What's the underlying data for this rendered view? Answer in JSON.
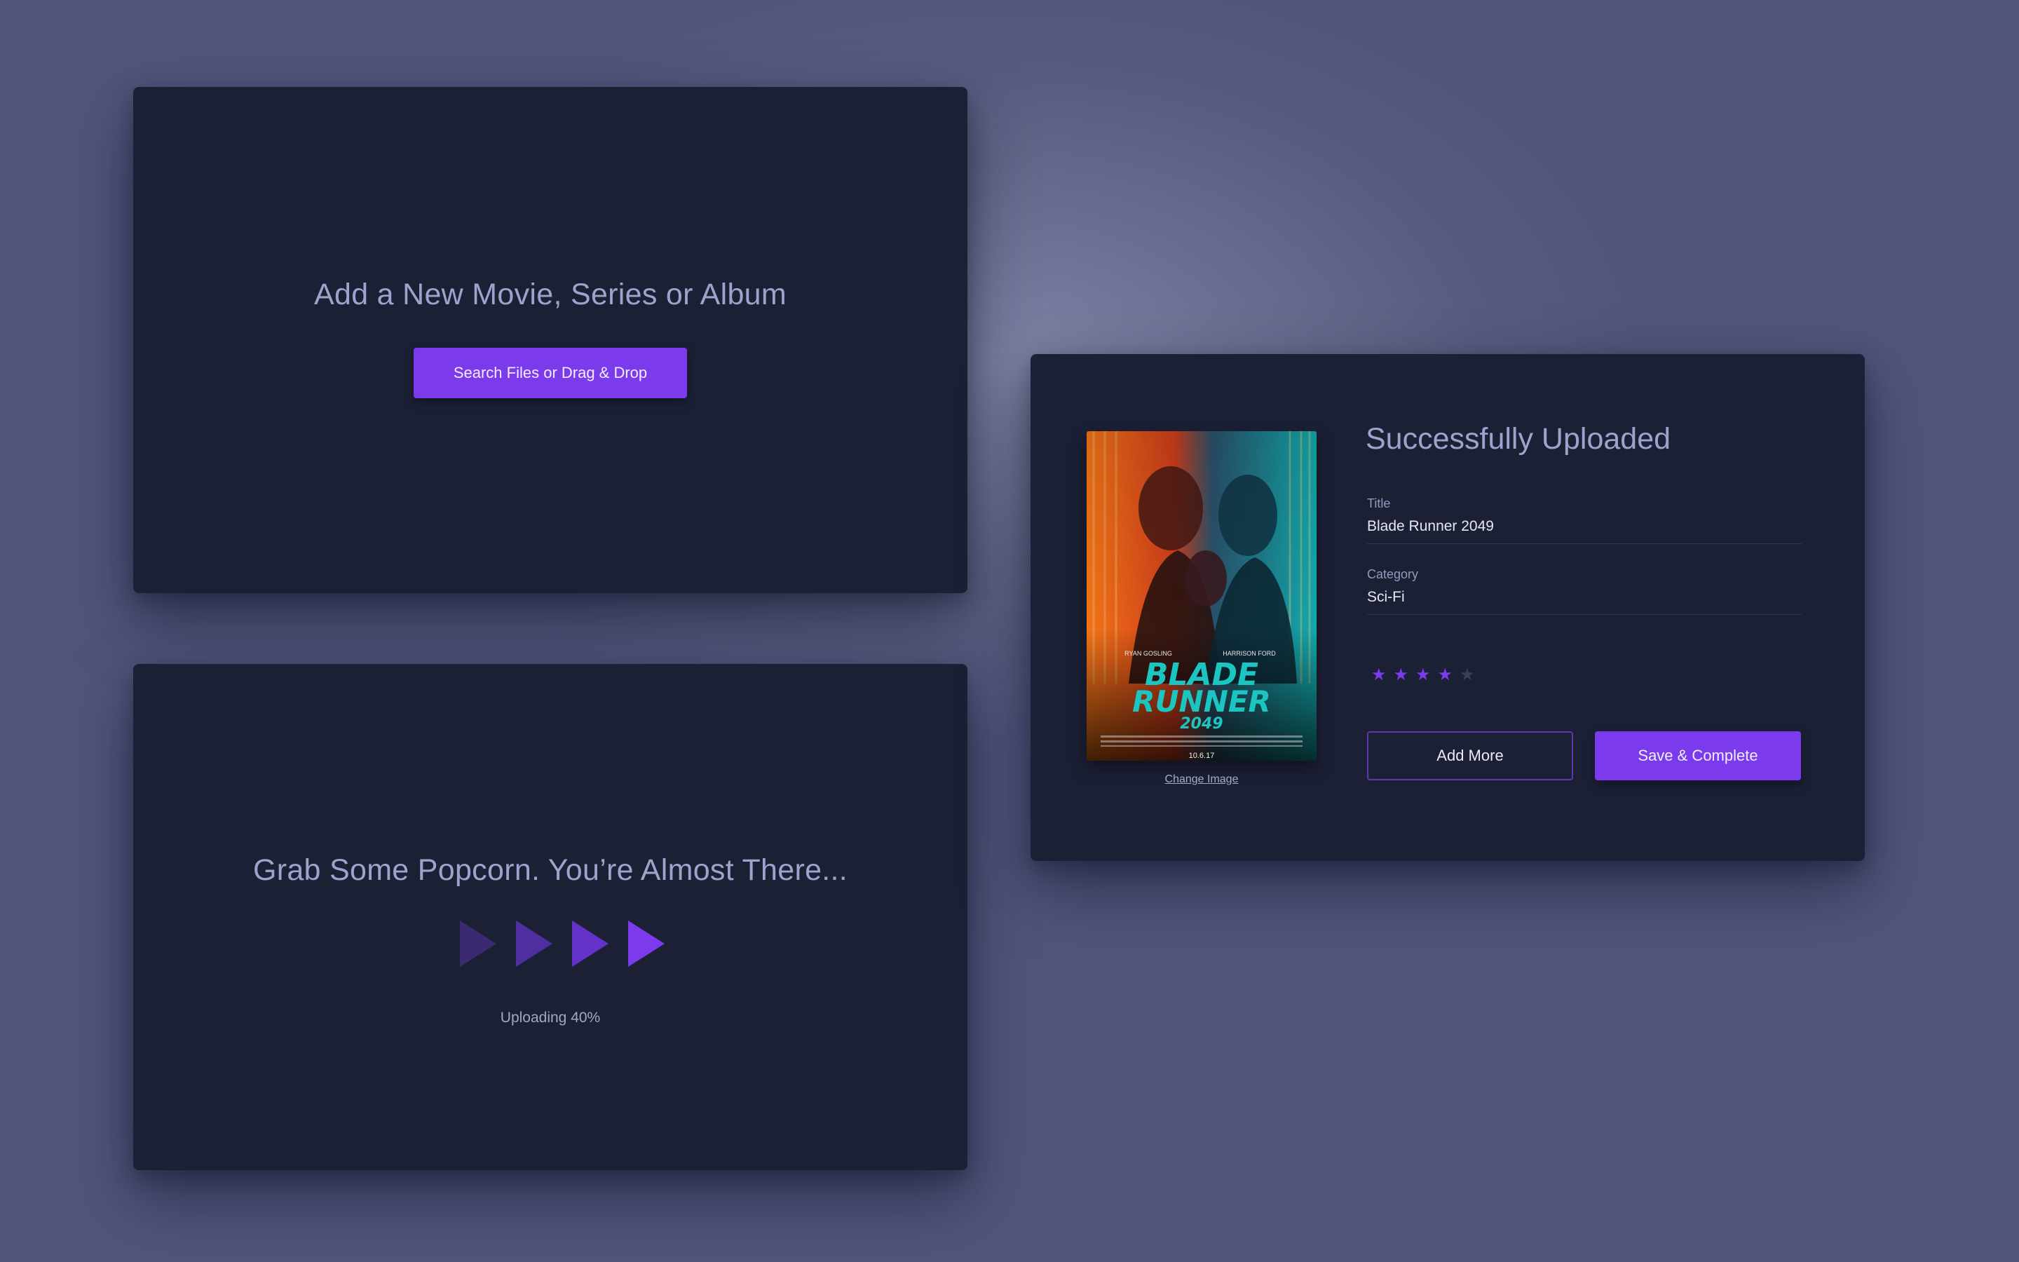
{
  "add_card": {
    "heading": "Add a New Movie, Series or Album",
    "button_label": "Search Files or Drag & Drop"
  },
  "progress_card": {
    "heading": "Grab Some Popcorn. You’re Almost There...",
    "status": "Uploading 40%",
    "progress_percent": 40
  },
  "success_card": {
    "heading": "Successfully Uploaded",
    "change_image_label": "Change Image",
    "poster": {
      "top_credits_left": "RYAN GOSLING",
      "top_credits_right": "HARRISON FORD",
      "title_line1": "BLADE",
      "title_line2": "RUNNER",
      "title_line3": "2049",
      "release_date": "10.6.17"
    },
    "fields": {
      "title_label": "Title",
      "title_value": "Blade Runner 2049",
      "category_label": "Category",
      "category_value": "Sci-Fi"
    },
    "rating": {
      "value": 4,
      "max": 5
    },
    "add_more_label": "Add More",
    "save_label": "Save & Complete"
  },
  "colors": {
    "accent": "#7c3aed",
    "card_bg": "#1c2035",
    "heading_text": "#9ea2cc",
    "star_on": "#7c3aed",
    "star_off": "#3a3e57"
  }
}
